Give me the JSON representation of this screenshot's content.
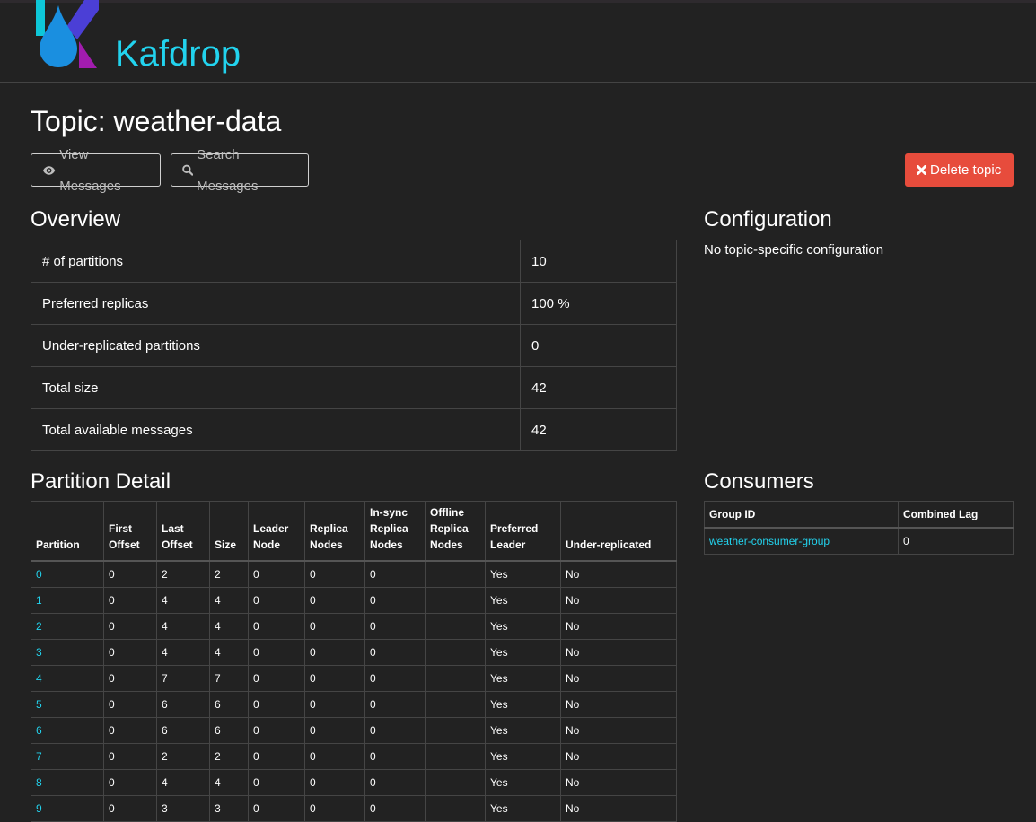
{
  "brand": {
    "name": "Kafdrop"
  },
  "page": {
    "title": "Topic: weather-data"
  },
  "buttons": {
    "view_messages": "View Messages",
    "search_messages": "Search Messages",
    "delete_topic": "Delete topic"
  },
  "overview": {
    "title": "Overview",
    "rows": [
      {
        "label": "# of partitions",
        "value": "10"
      },
      {
        "label": "Preferred replicas",
        "value": "100 %"
      },
      {
        "label": "Under-replicated partitions",
        "value": "0"
      },
      {
        "label": "Total size",
        "value": "42"
      },
      {
        "label": "Total available messages",
        "value": "42"
      }
    ]
  },
  "configuration": {
    "title": "Configuration",
    "text": "No topic-specific configuration"
  },
  "partition_detail": {
    "title": "Partition Detail",
    "headers": [
      "Partition",
      "First Offset",
      "Last Offset",
      "Size",
      "Leader Node",
      "Replica Nodes",
      "In-sync Replica Nodes",
      "Offline Replica Nodes",
      "Preferred Leader",
      "Under-replicated"
    ],
    "rows": [
      [
        "0",
        "0",
        "2",
        "2",
        "0",
        "0",
        "0",
        "",
        "Yes",
        "No"
      ],
      [
        "1",
        "0",
        "4",
        "4",
        "0",
        "0",
        "0",
        "",
        "Yes",
        "No"
      ],
      [
        "2",
        "0",
        "4",
        "4",
        "0",
        "0",
        "0",
        "",
        "Yes",
        "No"
      ],
      [
        "3",
        "0",
        "4",
        "4",
        "0",
        "0",
        "0",
        "",
        "Yes",
        "No"
      ],
      [
        "4",
        "0",
        "7",
        "7",
        "0",
        "0",
        "0",
        "",
        "Yes",
        "No"
      ],
      [
        "5",
        "0",
        "6",
        "6",
        "0",
        "0",
        "0",
        "",
        "Yes",
        "No"
      ],
      [
        "6",
        "0",
        "6",
        "6",
        "0",
        "0",
        "0",
        "",
        "Yes",
        "No"
      ],
      [
        "7",
        "0",
        "2",
        "2",
        "0",
        "0",
        "0",
        "",
        "Yes",
        "No"
      ],
      [
        "8",
        "0",
        "4",
        "4",
        "0",
        "0",
        "0",
        "",
        "Yes",
        "No"
      ],
      [
        "9",
        "0",
        "3",
        "3",
        "0",
        "0",
        "0",
        "",
        "Yes",
        "No"
      ]
    ]
  },
  "consumers": {
    "title": "Consumers",
    "headers": [
      "Group ID",
      "Combined Lag"
    ],
    "rows": [
      {
        "group_id": "weather-consumer-group",
        "lag": "0"
      }
    ]
  },
  "icons": {
    "view": "eye-icon",
    "search": "search-icon",
    "delete": "close-icon",
    "logo": "kafdrop-logo"
  },
  "colors": {
    "background": "#222222",
    "accent": "#22d3ee",
    "danger": "#e74c3c",
    "border": "#454545"
  }
}
